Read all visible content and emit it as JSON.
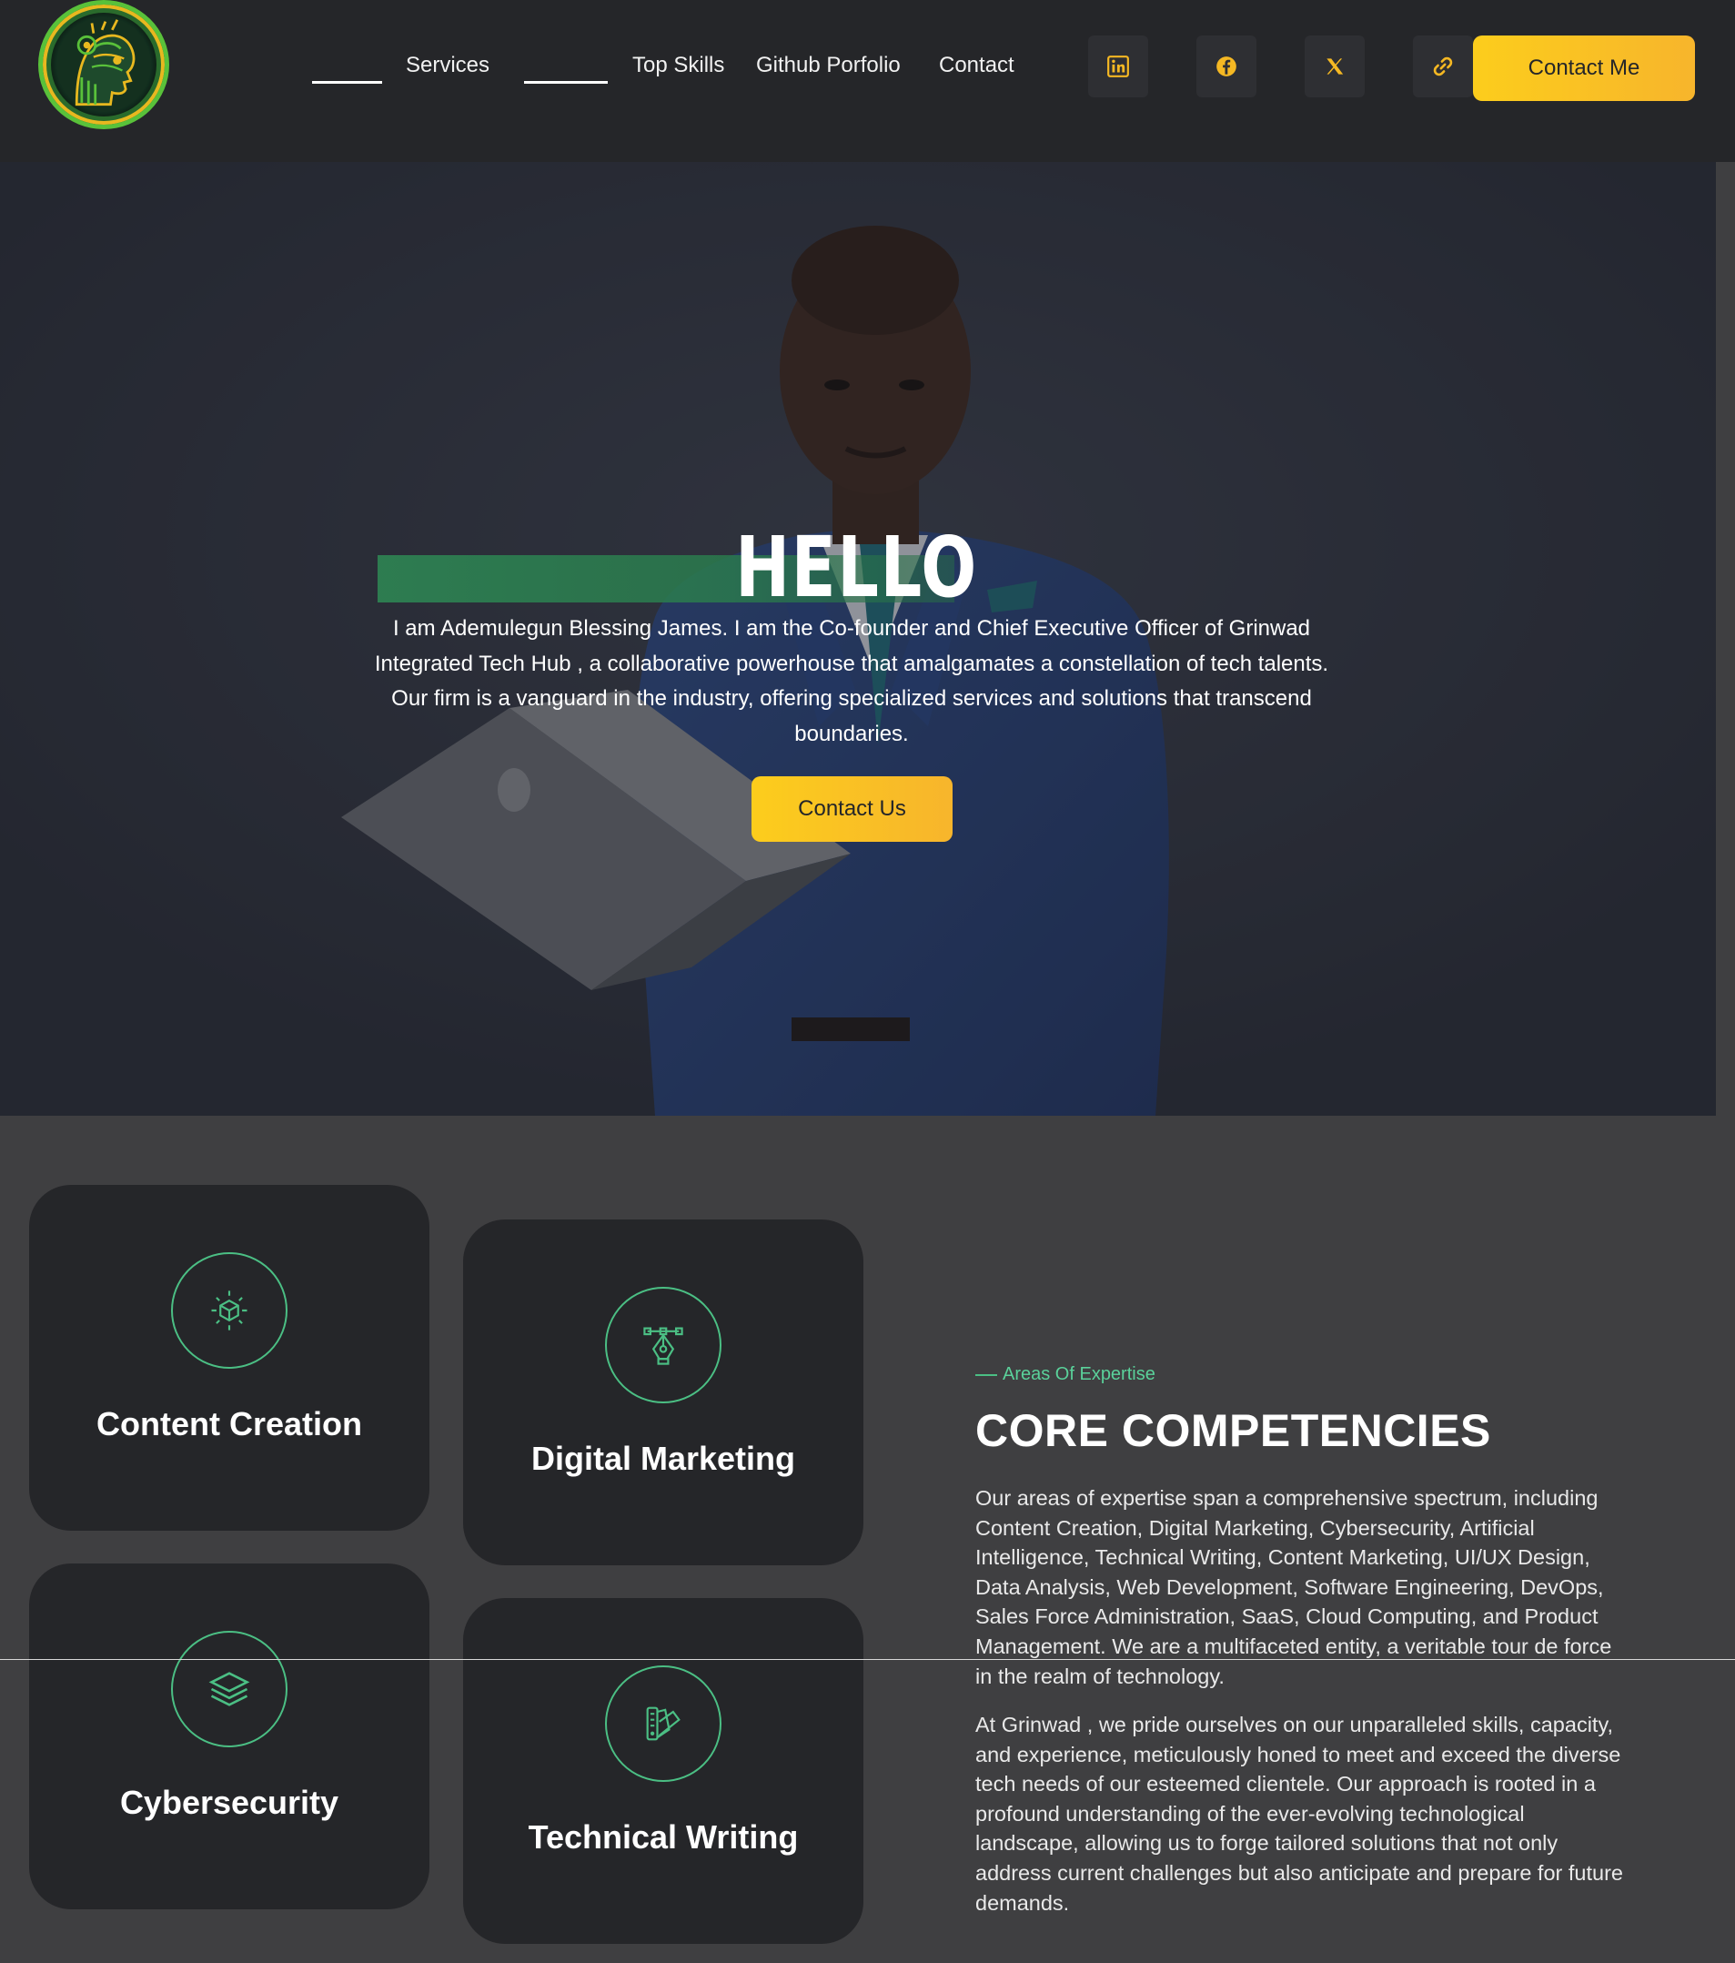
{
  "header": {
    "logo_icon": "robot-head-logo-icon",
    "nav": [
      {
        "label": ""
      },
      {
        "label": "Services"
      },
      {
        "label": ""
      },
      {
        "label": "Top Skills"
      },
      {
        "label": "Github Porfolio"
      },
      {
        "label": "Contact"
      }
    ],
    "socials": [
      {
        "icon": "linkedin-icon"
      },
      {
        "icon": "facebook-icon"
      },
      {
        "icon": "x-twitter-icon"
      },
      {
        "icon": "link-icon"
      }
    ],
    "cta_label": "Contact Me"
  },
  "hero": {
    "title": "HELLO",
    "text": "I am Ademulegun Blessing James. I am the Co-founder and Chief Executive Officer of Grinwad Integrated Tech Hub , a collaborative powerhouse that amalgamates a constellation of tech talents. Our firm is a vanguard in the industry, offering specialized services and solutions that transcend boundaries.",
    "cta_label": "Contact Us"
  },
  "competencies": {
    "cards": [
      {
        "title": "Content Creation",
        "icon": "cube-icon"
      },
      {
        "title": "Digital Marketing",
        "icon": "pen-tool-icon"
      },
      {
        "title": "Cybersecurity",
        "icon": "layers-icon"
      },
      {
        "title": "Technical Writing",
        "icon": "color-swatch-icon"
      }
    ],
    "eyebrow": "Areas Of Expertise",
    "heading": "CORE COMPETENCIES",
    "paragraph1": "Our areas of expertise span a comprehensive spectrum, including Content Creation, Digital Marketing, Cybersecurity, Artificial Intelligence, Technical Writing, Content Marketing, UI/UX Design, Data Analysis, Web Development, Software Engineering, DevOps, Sales Force Administration, SaaS, Cloud Computing, and Product Management. We are a multifaceted entity, a veritable tour de force in the realm of technology.",
    "paragraph2": "At Grinwad , we pride ourselves on our unparalleled skills, capacity, and experience, meticulously honed to meet and exceed the diverse tech needs of our esteemed clientele. Our approach is rooted in a profound understanding of the ever-evolving technological landscape, allowing us to forge tailored solutions that not only address current challenges but also anticipate and prepare for future demands."
  },
  "colors": {
    "accent_yellow": "#fccd1c",
    "accent_green": "#4bbf84",
    "header_bg": "#252629",
    "section_bg": "#3f3f41"
  }
}
